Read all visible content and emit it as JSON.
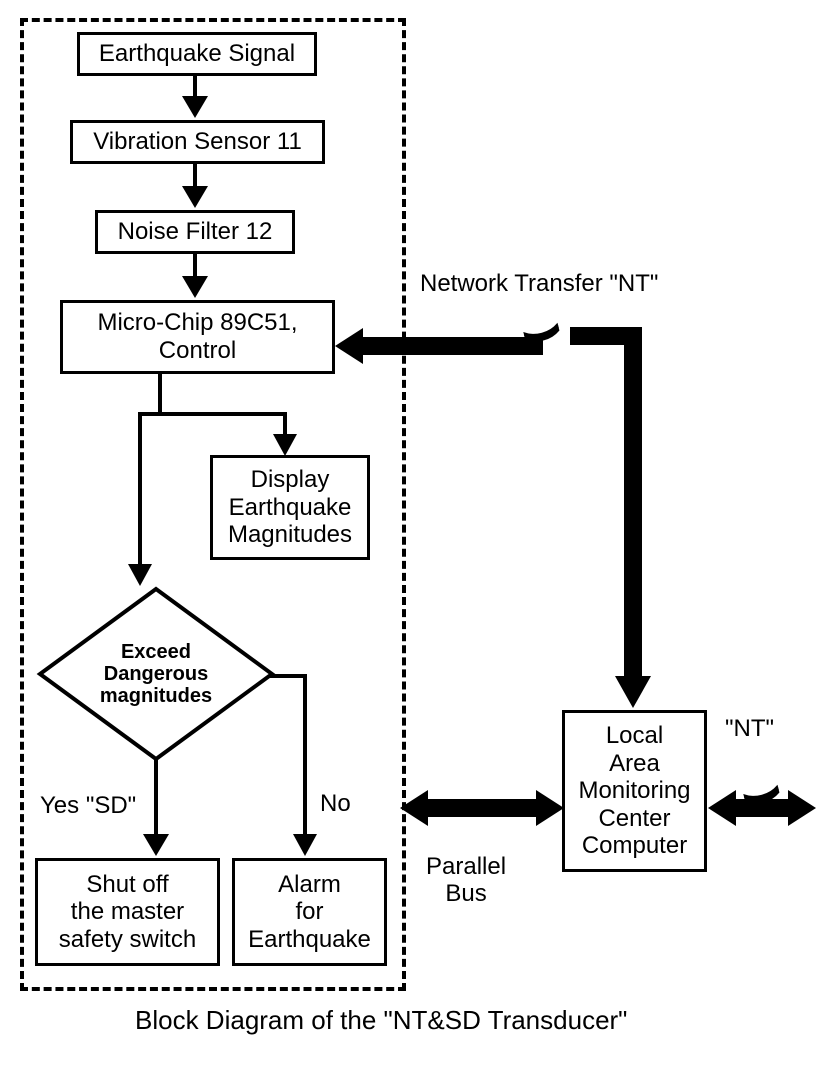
{
  "boxes": {
    "signal": "Earthquake Signal",
    "sensor": "Vibration Sensor 11",
    "filter": "Noise Filter 12",
    "micro": "Micro-Chip 89C51,\nControl",
    "display": "Display\nEarthquake\nMagnitudes",
    "decision": "Exceed\nDangerous\nmagnitudes",
    "shut": "Shut off\nthe master\nsafety switch",
    "alarm": "Alarm\nfor\nEarthquake",
    "local": "Local\nArea\nMonitoring\nCenter\nComputer"
  },
  "labels": {
    "yes": "Yes \"SD\"",
    "no": "No",
    "parallel_bus": "Parallel\nBus",
    "network_transfer": "Network Transfer \"NT\"",
    "nt": "\"NT\""
  },
  "title": "Block Diagram of the \"NT&SD Transducer\""
}
